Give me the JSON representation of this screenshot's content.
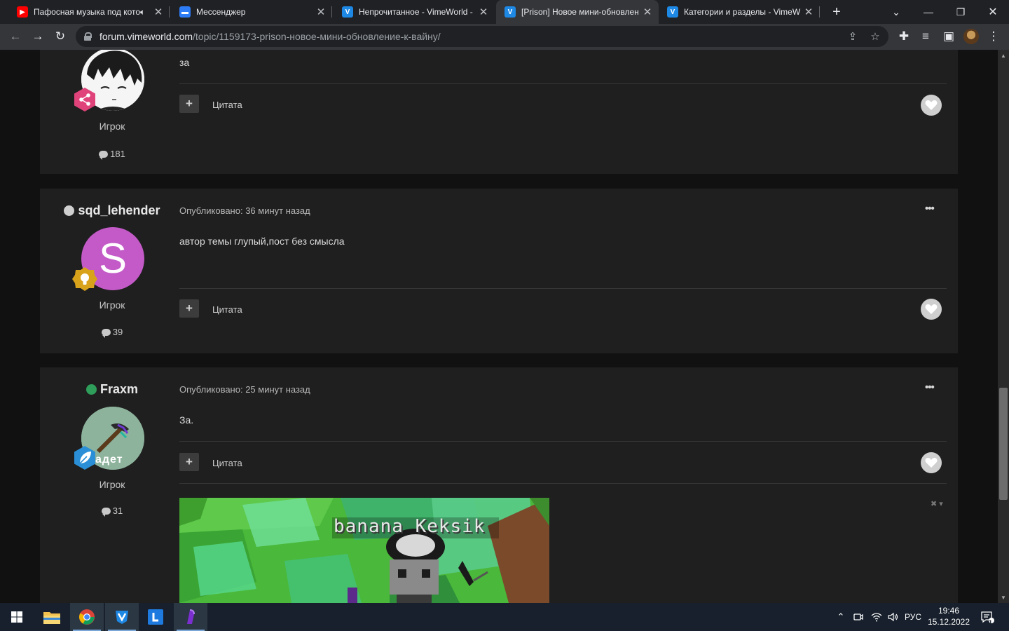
{
  "browser": {
    "tabs": [
      {
        "title": "Пафосная музыка под кото",
        "favicon": "youtube-icon",
        "audio": true
      },
      {
        "title": "Мессенджер",
        "favicon": "messenger-icon"
      },
      {
        "title": "Непрочитанное - VimeWorld -",
        "favicon": "vimeworld-icon"
      },
      {
        "title": "[Prison] Новое мини-обновлен",
        "favicon": "vimeworld-icon",
        "active": true
      },
      {
        "title": "Категории и разделы - VimeW",
        "favicon": "vimeworld-icon"
      }
    ],
    "url_host": "forum.vimeworld.com",
    "url_path": "/topic/1159173-prison-новое-мини-обновление-к-вайну/"
  },
  "posts": [
    {
      "author": "",
      "online": null,
      "meta": "",
      "body": "за",
      "role": "Игрок",
      "post_count": "181",
      "quote_label": "Цитата"
    },
    {
      "author": "sqd_lehender",
      "online": false,
      "meta": "Опубликовано: 36 минут назад",
      "body": "автор темы глупый,пост без смысла",
      "avatar_letter": "S",
      "role": "Игрок",
      "post_count": "39",
      "quote_label": "Цитата"
    },
    {
      "author": "Fraxm",
      "online": true,
      "meta": "Опубликовано: 25 минут назад",
      "body": "За.",
      "avatar_text": "адет",
      "role": "Игрок",
      "post_count": "31",
      "quote_label": "Цитата",
      "image_caption": "banana Keksik"
    }
  ],
  "taskbar": {
    "language": "РУС",
    "time": "19:46",
    "date": "15.12.2022",
    "notifications": "1"
  },
  "colors": {
    "online": "#2f9e5a",
    "offline": "#cfcfcf",
    "avatar_s": "#c35ac8"
  }
}
